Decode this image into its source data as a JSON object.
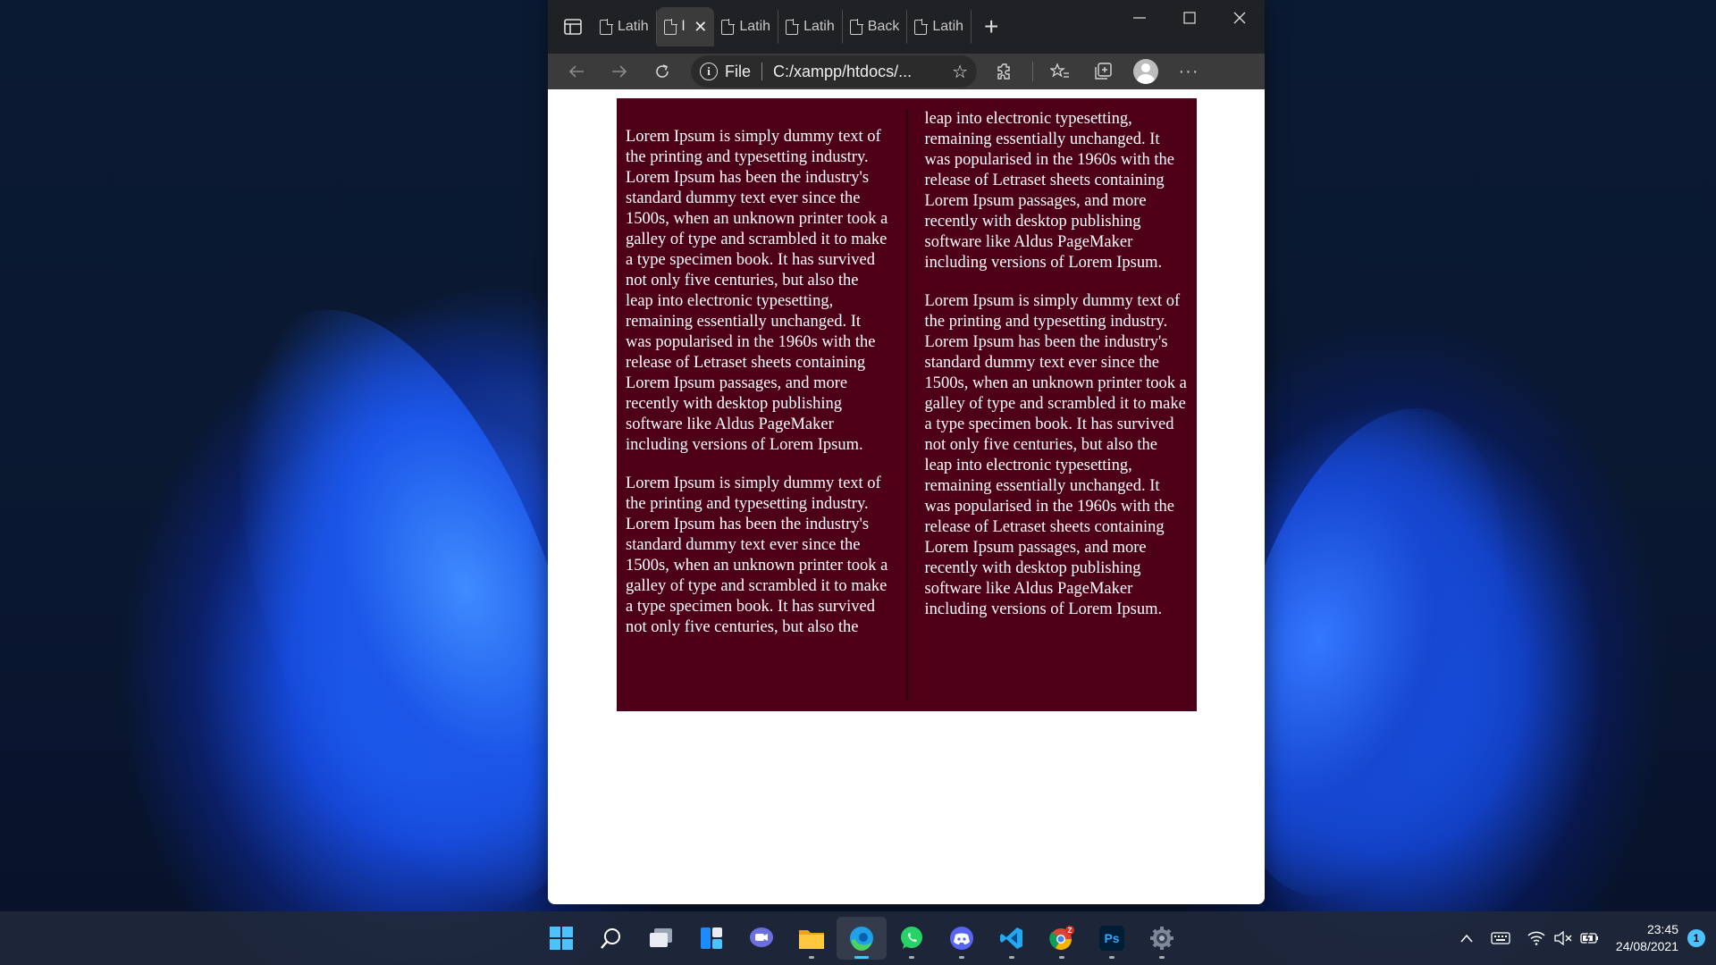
{
  "browser": {
    "tabs": [
      {
        "title": "Latih",
        "active": false
      },
      {
        "title": "l",
        "active": true
      },
      {
        "title": "Latih",
        "active": false
      },
      {
        "title": "Latih",
        "active": false
      },
      {
        "title": "Back",
        "active": false
      },
      {
        "title": "Latih",
        "active": false
      }
    ],
    "new_tab_symbol": "+",
    "address": {
      "scheme_label": "File",
      "url": "C:/xampp/htdocs/..."
    }
  },
  "page": {
    "paragraphs": [
      "Lorem Ipsum is simply dummy text of the printing and typesetting industry. Lorem Ipsum has been the industry's standard dummy text ever since the 1500s, when an unknown printer took a galley of type and scrambled it to make a type specimen book. It has survived not only five centuries, but also the leap into electronic typesetting, remaining essentially unchanged. It was popularised in the 1960s with the release of Letraset sheets containing Lorem Ipsum passages, and more recently with desktop publishing software like Aldus PageMaker including versions of Lorem Ipsum.",
      "Lorem Ipsum is simply dummy text of the printing and typesetting industry. Lorem Ipsum has been the industry's standard dummy text ever since the 1500s, when an unknown printer took a galley of type and scrambled it to make a type specimen book. It has survived not only five centuries, but also the leap into electronic typesetting, remaining essentially unchanged. It was popularised in the 1960s with the release of Letraset sheets containing Lorem Ipsum passages, and more recently with desktop publishing software like Aldus PageMaker including versions of Lorem Ipsum.",
      "Lorem Ipsum is simply dummy text of the printing and typesetting industry. Lorem Ipsum has been the industry's standard dummy text ever since the 1500s, when an unknown printer took a galley of type and scrambled it to make a type specimen book. It has survived not only five centuries, but also the leap into electronic typesetting, remaining essentially unchanged. It was popularised in the 1960s with the release of Letraset sheets containing Lorem Ipsum passages, and more recently with desktop publishing software like Aldus PageMaker including versions of Lorem Ipsum."
    ],
    "box_color": "#4d0018",
    "text_color": "#ffffff"
  },
  "taskbar": {
    "apps": [
      {
        "name": "start",
        "icon": "windows-logo-icon",
        "running": false
      },
      {
        "name": "search",
        "icon": "search-icon",
        "running": false
      },
      {
        "name": "task-view",
        "icon": "task-view-icon",
        "running": false
      },
      {
        "name": "widgets",
        "icon": "widgets-icon",
        "running": false
      },
      {
        "name": "teams-chat",
        "icon": "chat-icon",
        "running": false
      },
      {
        "name": "file-explorer",
        "icon": "folder-icon",
        "running": true
      },
      {
        "name": "edge",
        "icon": "edge-icon",
        "running": true,
        "active": true
      },
      {
        "name": "whatsapp",
        "icon": "whatsapp-icon",
        "running": true
      },
      {
        "name": "discord",
        "icon": "discord-icon",
        "running": true
      },
      {
        "name": "vscode",
        "icon": "vscode-icon",
        "running": true
      },
      {
        "name": "chrome",
        "icon": "chrome-icon",
        "running": true,
        "badge": "Z"
      },
      {
        "name": "photoshop",
        "icon": "photoshop-icon",
        "running": true,
        "label": "Ps"
      },
      {
        "name": "settings",
        "icon": "settings-gear-icon",
        "running": true
      }
    ],
    "time": "23:45",
    "date": "24/08/2021",
    "notification_count": "1",
    "accent": "#4cc2ff"
  }
}
